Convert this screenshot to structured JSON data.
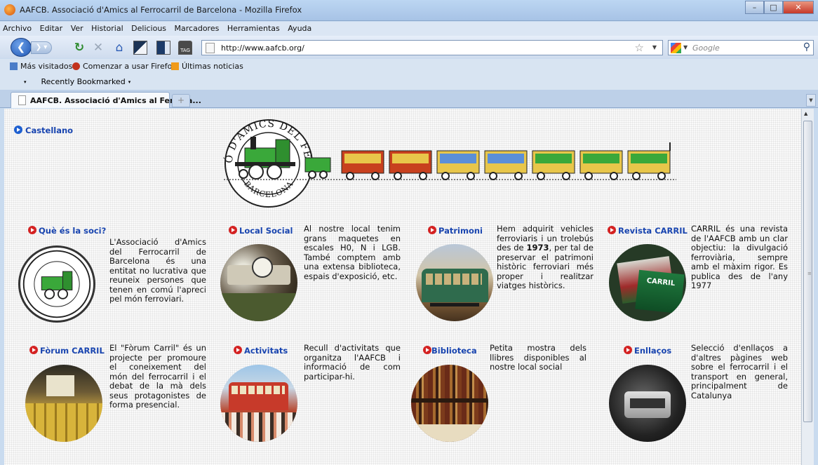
{
  "window": {
    "title": "AAFCB. Associació d'Amics al Ferrocarril de Barcelona - Mozilla Firefox"
  },
  "menu": [
    "Archivo",
    "Editar",
    "Ver",
    "Historial",
    "Delicious",
    "Marcadores",
    "Herramientas",
    "Ayuda"
  ],
  "nav": {
    "url": "http://www.aafcb.org/",
    "search_placeholder": "Google",
    "tag_label": "TAG"
  },
  "bookmarks": {
    "most_visited": "Más visitados",
    "getting_started": "Comenzar a usar Firefox",
    "latest_news": "Últimas noticias",
    "recently_bookmarked": "Recently Bookmarked"
  },
  "tab": {
    "label": "AAFCB. Associació d'Amics al Ferroca...",
    "new_tab": "+"
  },
  "page": {
    "language_link": "Castellano",
    "logo_text": {
      "top": "ASSOCIACIÓ D'AMICS DEL FERROCARRIL",
      "bottom": "BARCELONA"
    },
    "sections": [
      {
        "title": "Què és la soci?",
        "text": "L'Associació d'Amics del Ferrocarril de Barcelona és una entitat no lucrativa que reuneix persones que tenen en comú l'apreci pel món ferroviari."
      },
      {
        "title": "Local Social",
        "text": "Al nostre local tenim grans maquetes en escales H0, N i LGB. També comptem amb una extensa biblioteca, espais d'exposició, etc."
      },
      {
        "title": "Patrimoni",
        "text_before": "Hem adquirit vehicles ferroviaris i un trolebús des de ",
        "text_bold": "1973",
        "text_after": ", per tal de preservar el patrimoni històric ferroviari més proper i realitzar viatges històrics."
      },
      {
        "title": "Revista CARRIL",
        "text": "CARRIL és una revista de l'AAFCB amb un clar objectiu: la divulgació ferroviària, sempre amb el màxim rigor. Es publica des de l'any 1977",
        "image_label": "CARRIL"
      },
      {
        "title": "Fòrum CARRIL",
        "text": "El \"Fòrum Carril\" és un projecte per promoure el coneixement del món del ferrocarril i el debat de la mà dels seus protagonistes de forma presencial."
      },
      {
        "title": "Activitats",
        "text": "Recull d'activitats que organitza l'AAFCB i informació de com participar-hi."
      },
      {
        "title": "Biblioteca",
        "text": "Petita mostra dels llibres disponibles al nostre local social"
      },
      {
        "title": "Enllaços",
        "text": "Selecció d'enllaços a d'altres pàgines web sobre el ferrocarril i el transport en general, principalment de Catalunya"
      }
    ]
  },
  "colors": {
    "link_blue": "#1945b0",
    "bullet_blue": "#1d5fd0",
    "bullet_red": "#d42222",
    "locomotive_green": "#3aa83a",
    "carriage_red": "#c8401e",
    "carriage_yellow": "#e8c64a"
  }
}
